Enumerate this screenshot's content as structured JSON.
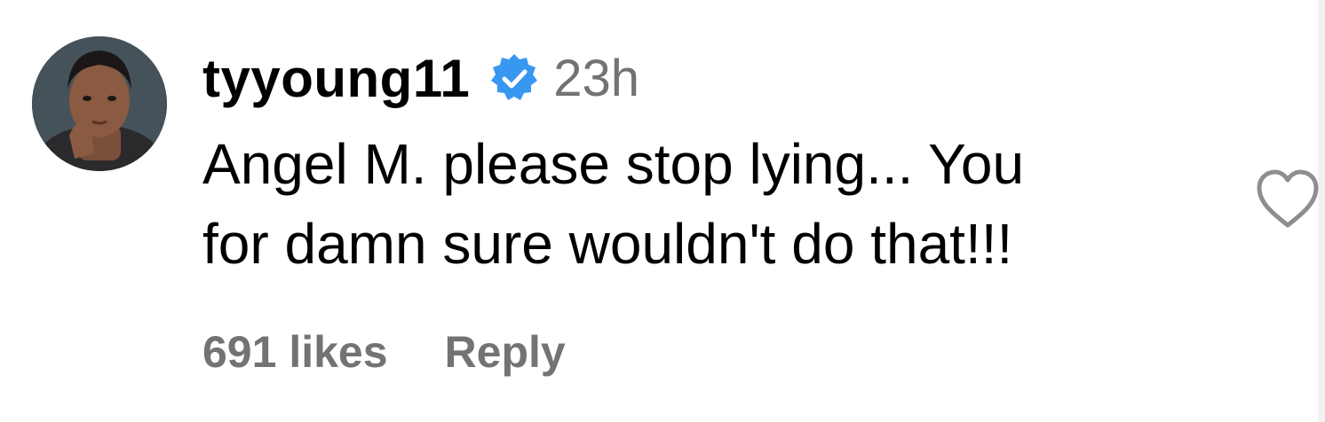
{
  "comment": {
    "username": "tyyoung11",
    "verified": true,
    "timestamp": "23h",
    "text": "Angel M. please stop lying... You\nfor damn sure wouldn't do that!!!",
    "likes": "691 likes",
    "reply_label": "Reply",
    "icons": {
      "avatar": "profile-photo",
      "verified": "verified-badge-icon",
      "like": "heart-outline-icon"
    },
    "colors": {
      "verified_badge": "#3897f0",
      "muted_text": "#737373",
      "heart_outline": "#8e8e8e"
    }
  }
}
